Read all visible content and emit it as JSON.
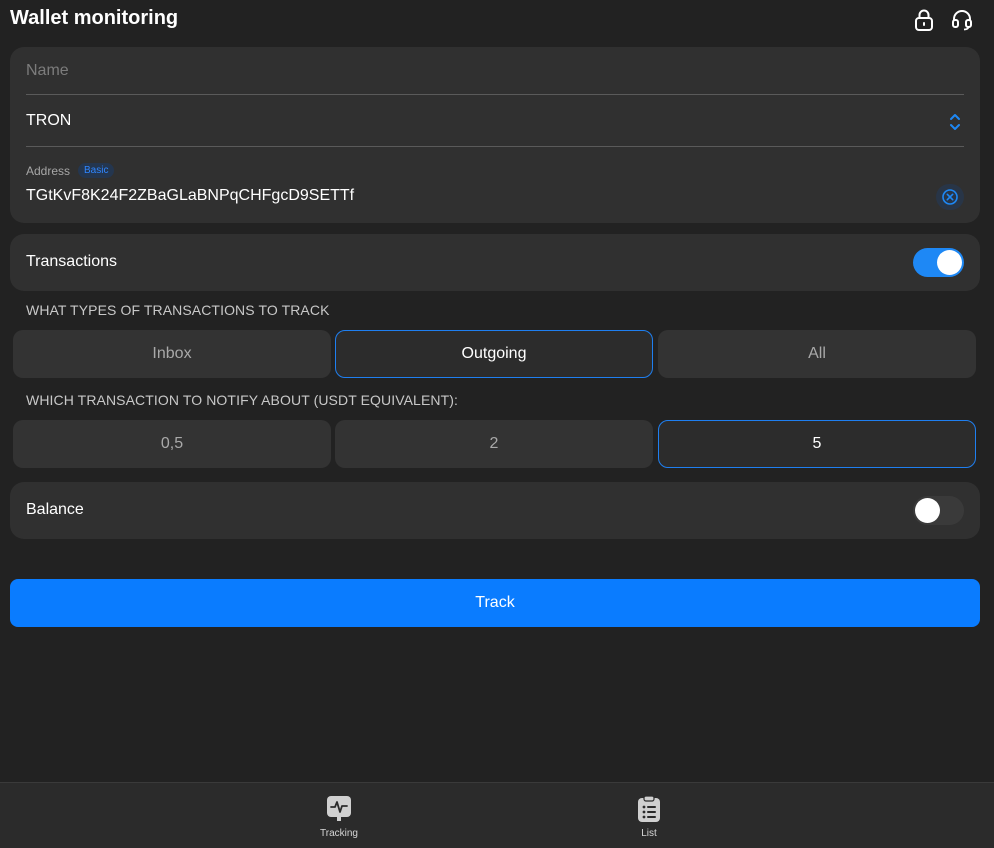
{
  "header": {
    "title": "Wallet monitoring",
    "lock_icon": "lock-icon",
    "support_icon": "headset-icon"
  },
  "form": {
    "name_placeholder": "Name",
    "name_value": "",
    "network_value": "TRON",
    "address_label": "Address",
    "address_badge": "Basic",
    "address_value": "TGtKvF8K24F2ZBaGLaBNPqCHFgcD9SETTf"
  },
  "transactions": {
    "label": "Transactions",
    "enabled": true
  },
  "types_section": {
    "label": "WHAT TYPES OF TRANSACTIONS TO TRACK",
    "options": [
      "Inbox",
      "Outgoing",
      "All"
    ],
    "selected": "Outgoing"
  },
  "threshold_section": {
    "label": "WHICH TRANSACTION TO NOTIFY ABOUT (USDT EQUIVALENT):",
    "options": [
      "0,5",
      "2",
      "5"
    ],
    "selected": "5"
  },
  "balance": {
    "label": "Balance",
    "enabled": false
  },
  "actions": {
    "track_label": "Track"
  },
  "bottom_nav": {
    "items": [
      {
        "label": "Tracking",
        "icon": "tracking-chart-icon"
      },
      {
        "label": "List",
        "icon": "clipboard-list-icon"
      }
    ]
  },
  "colors": {
    "background": "#222222",
    "card": "#303030",
    "accent": "#0a7cff",
    "toggle_on": "#1e88f5"
  }
}
